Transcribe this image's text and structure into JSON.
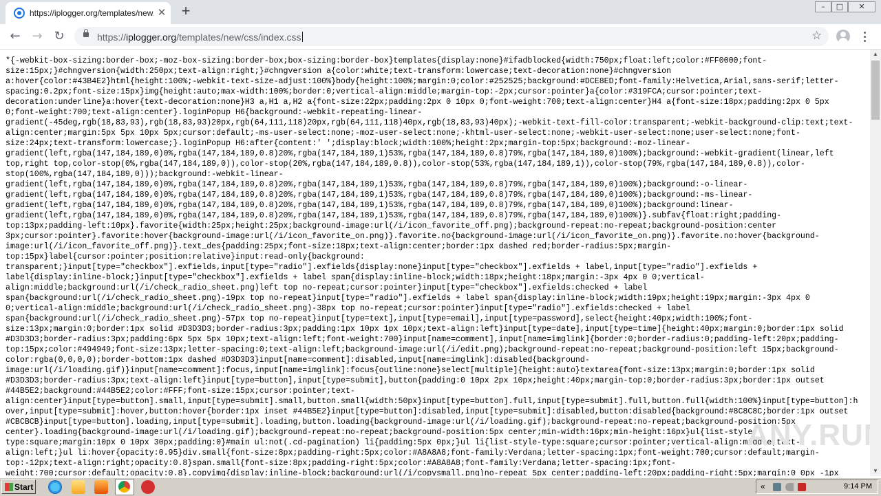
{
  "browser": {
    "tab": {
      "title": "https://iplogger.org/templates/new/css/index.css",
      "close_glyph": "✕"
    },
    "new_tab_glyph": "+",
    "window_controls": [
      "–",
      "□",
      "✕"
    ],
    "nav": {
      "back": "←",
      "forward": "→",
      "reload": "↻"
    },
    "address": {
      "scheme": "https://",
      "host": "iplogger.org",
      "path": "/templates/new/css/index.css"
    },
    "bookmark_glyph": "☆"
  },
  "page": {
    "lines": [
      "*{-webkit-box-sizing:border-box;-moz-box-sizing:border-box;box-sizing:border-box}templates{display:none}#ifadblocked{width:750px;float:left;color:#FF0000;font-",
      "size:15px;}#chngversion{width:250px;text-align:right;}#chngversion a{color:white;text-transform:lowercase;text-decoration:none}#chngversion",
      "a:hover{color:#43B4E2}html{height:100%;-webkit-text-size-adjust:100%}body{height:100%;margin:0;color:#252525;background:#DCE8ED;font-family:Helvetica,Arial,sans-serif;letter-",
      "spacing:0.2px;font-size:15px}img{height:auto;max-width:100%;border:0;vertical-align:middle;margin-top:-2px;cursor:pointer}a{color:#319FCA;cursor:pointer;text-",
      "decoration:underline}a:hover{text-decoration:none}H3 a,H1 a,H2 a{font-size:22px;padding:2px 0 10px 0;font-weight:700;text-align:center}H4 a{font-size:18px;padding:2px 0 5px",
      "0;font-weight:700;text-align:center}.loginPopup H6{background:-webkit-repeating-linear-",
      "gradient(-45deg,rgb(18,83,93),rgb(18,83,93)20px,rgb(64,111,118)20px,rgb(64,111,118)40px,rgb(18,83,93)40px);-webkit-text-fill-color:transparent;-webkit-background-clip:text;text-",
      "align:center;margin:5px 5px 10px 5px;cursor:default;-ms-user-select:none;-moz-user-select:none;-khtml-user-select:none;-webkit-user-select:none;user-select:none;font-",
      "size:24px;text-transform:lowercase;}.loginPopup H6:after{content:' ';display:block;width:100%;height:2px;margin-top:5px;background:-moz-linear-",
      "gradient(left,rgba(147,184,189,0)0%,rgba(147,184,189,0.8)20%,rgba(147,184,189,1)53%,rgba(147,184,189,0.8)79%,rgba(147,184,189,0)100%);background:-webkit-gradient(linear,left",
      "top,right top,color-stop(0%,rgba(147,184,189,0)),color-stop(20%,rgba(147,184,189,0.8)),color-stop(53%,rgba(147,184,189,1)),color-stop(79%,rgba(147,184,189,0.8)),color-",
      "stop(100%,rgba(147,184,189,0)));background:-webkit-linear-",
      "gradient(left,rgba(147,184,189,0)0%,rgba(147,184,189,0.8)20%,rgba(147,184,189,1)53%,rgba(147,184,189,0.8)79%,rgba(147,184,189,0)100%);background:-o-linear-",
      "gradient(left,rgba(147,184,189,0)0%,rgba(147,184,189,0.8)20%,rgba(147,184,189,1)53%,rgba(147,184,189,0.8)79%,rgba(147,184,189,0)100%);background:-ms-linear-",
      "gradient(left,rgba(147,184,189,0)0%,rgba(147,184,189,0.8)20%,rgba(147,184,189,1)53%,rgba(147,184,189,0.8)79%,rgba(147,184,189,0)100%);background:linear-",
      "gradient(left,rgba(147,184,189,0)0%,rgba(147,184,189,0.8)20%,rgba(147,184,189,1)53%,rgba(147,184,189,0.8)79%,rgba(147,184,189,0)100%)}.subfav{float:right;padding-",
      "top:13px;padding-left:10px}.favorite{width:25px;height:25px;background-image:url(/i/icon_favorite_off.png);background-repeat:no-repeat;background-position:center",
      "3px;cursor:pointer}.favorite:hover{background-image:url(/i/icon_favorite_on.png)}.favorite.no{background-image:url(/i/icon_favorite_on.png)}.favorite.no:hover{background-",
      "image:url(/i/icon_favorite_off.png)}.text_des{padding:25px;font-size:18px;text-align:center;border:1px dashed red;border-radius:5px;margin-",
      "top:15px}label{cursor:pointer;position:relative}input:read-only{background:",
      "transparent;}input[type=\"checkbox\"].exfields,input[type=\"radio\"].exfields{display:none}input[type=\"checkbox\"].exfields + label,input[type=\"radio\"].exfields +",
      "label{display:inline-block;}input[type=\"checkbox\"].exfields + label span{display:inline-block;width:18px;height:18px;margin:-3px 4px 0 0;vertical-",
      "align:middle;background:url(/i/check_radio_sheet.png)left top no-repeat;cursor:pointer}input[type=\"checkbox\"].exfields:checked + label",
      "span{background:url(/i/check_radio_sheet.png)-19px top no-repeat}input[type=\"radio\"].exfields + label span{display:inline-block;width:19px;height:19px;margin:-3px 4px 0",
      "0;vertical-align:middle;background:url(/i/check_radio_sheet.png)-38px top no-repeat;cursor:pointer}input[type=\"radio\"].exfields:checked + label",
      "span{background:url(/i/check_radio_sheet.png)-57px top no-repeat}input[type=text],input[type=email],input[type=password],select{height:40px;width:100%;font-",
      "size:13px;margin:0;border:1px solid #D3D3D3;border-radius:3px;padding:1px 10px 1px 10px;text-align:left}input[type=date],input[type=time]{height:40px;margin:0;border:1px solid",
      "#D3D3D3;border-radius:3px;padding:6px 5px 5px 10px;text-align:left;font-weight:700}input[name=comment],input[name=imglink]{border:0;border-radius:0;padding-left:20px;padding-",
      "top:15px;color:#494949;font-size:13px;letter-spacing:0;text-align:left;background-image:url(/i/edit.png);background-repeat:no-repeat;background-position:left 15px;background-",
      "color:rgba(0,0,0,0);border-bottom:1px dashed #D3D3D3}input[name=comment]:disabled,input[name=imglink]:disabled{background-",
      "image:url(/i/loading.gif)}input[name=comment]:focus,input[name=imglink]:focus{outline:none}select[multiple]{height:auto}textarea{font-size:13px;margin:0;border:1px solid",
      "#D3D3D3;border-radius:3px;text-align:left}input[type=button],input[type=submit],button{padding:0 10px 2px 10px;height:40px;margin-top:0;border-radius:3px;border:1px outset",
      "#44B5E2;background:#44B5E2;color:#FFF;font-size:15px;cursor:pointer;text-",
      "align:center}input[type=button].small,input[type=submit].small,button.small{width:50px}input[type=button].full,input[type=submit].full,button.full{width:100%}input[type=button]:h",
      "over,input[type=submit]:hover,button:hover{border:1px inset #44B5E2}input[type=button]:disabled,input[type=submit]:disabled,button:disabled{background:#8C8C8C;border:1px outset",
      "#CBCBCB}input[type=button].loading,input[type=submit].loading,button.loading{background-image:url(/i/loading.gif);background-repeat:no-repeat;background-position:5px",
      "center}.loading{background-image:url(/i/loading.gif);background-repeat:no-repeat;background-position:5px center;min-width:16px;min-height:16px}ul{list-style-",
      "type:square;margin:10px 0 10px 30px;padding:0}#main ul:not(.cd-pagination) li{padding:5px 0px;}ul li{list-style-type:square;cursor:pointer;vertical-align:middle;text-",
      "align:left;}ul li:hover{opacity:0.95}div.small{font-size:8px;padding-right:5px;color:#A8A8A8;font-family:Verdana;letter-spacing:1px;font-weight:700;cursor:default;margin-",
      "top:-12px;text-align:right;opacity:0.8}span.small{font-size:8px;padding-right:5px;color:#A8A8A8;font-family:Verdana;letter-spacing:1px;font-",
      "weight:700;cursor:default;opacity:0.8}.copyimg{display:inline-block;background:url(/i/copysmall.png)no-repeat 5px center;padding-left:20px;padding-right:5px;margin:0 0px -1px"
    ]
  },
  "scrollbar": {
    "up": "▲",
    "down": "▼"
  },
  "watermark": "ANY.RUN",
  "taskbar": {
    "start_label": "Start",
    "clock": "9:14 PM",
    "tray_arrow": "«"
  }
}
